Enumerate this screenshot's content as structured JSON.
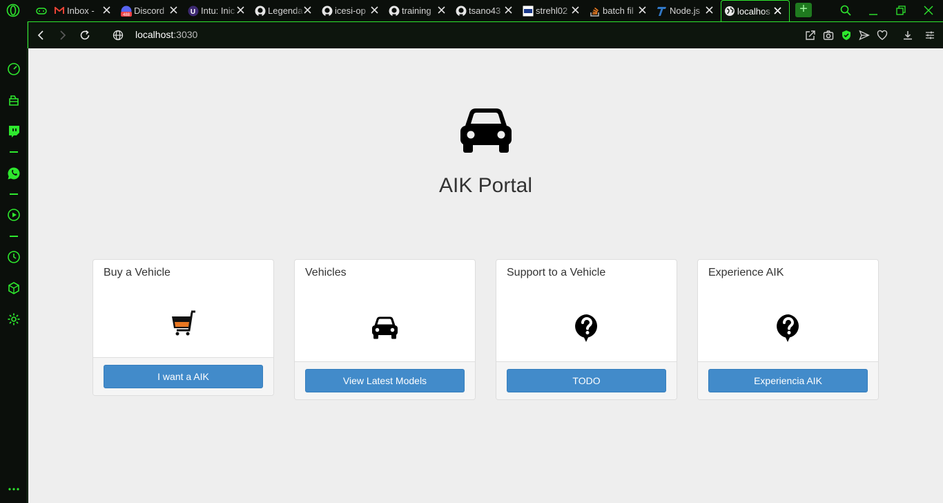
{
  "browser": {
    "tabs": [
      {
        "title": "",
        "icon": "gamepad-icon"
      },
      {
        "title": "Inbox - ",
        "icon": "gmail-icon"
      },
      {
        "title": "Discord",
        "icon": "discord-icon",
        "badge": "488"
      },
      {
        "title": "Intu: Inic",
        "icon": "intu-icon"
      },
      {
        "title": "Legenda",
        "icon": "github-icon"
      },
      {
        "title": "icesi-op",
        "icon": "github-icon"
      },
      {
        "title": "training",
        "icon": "github-icon"
      },
      {
        "title": "tsano43",
        "icon": "github-icon"
      },
      {
        "title": "strehl02",
        "icon": "site-icon"
      },
      {
        "title": "batch fil",
        "icon": "stackoverflow-icon"
      },
      {
        "title": "Node.js",
        "icon": "typescript-icon"
      },
      {
        "title": "localhos",
        "icon": "globe-icon",
        "active": true
      }
    ],
    "new_tab_label": "+",
    "url_host": "localhost",
    "url_port": ":3030",
    "accent_color": "#2ee82e"
  },
  "page": {
    "title": "AIK Portal",
    "hero_icon": "car-icon",
    "cards": [
      {
        "title": "Buy a Vehicle",
        "icon": "shopping-cart-icon",
        "button": "I want a AIK"
      },
      {
        "title": "Vehicles",
        "icon": "car-icon",
        "button": "View Latest Models"
      },
      {
        "title": "Support to a Vehicle",
        "icon": "question-bubble-icon",
        "button": "TODO"
      },
      {
        "title": "Experience AIK",
        "icon": "question-bubble-icon",
        "button": "Experiencia AIK"
      }
    ],
    "button_color": "#428bca"
  }
}
